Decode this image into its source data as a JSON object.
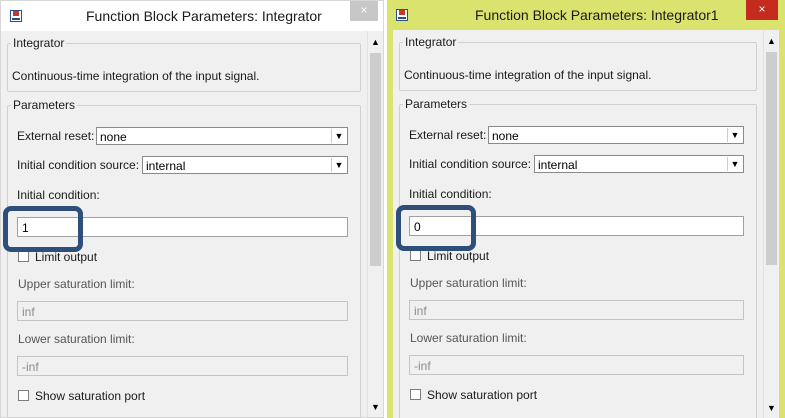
{
  "windows": [
    {
      "title": "Function Block Parameters: Integrator",
      "close_glyph": "×",
      "mask_type": "Integrator",
      "description": "Continuous-time integration of the input signal.",
      "parameters_title": "Parameters",
      "external_reset": {
        "label": "External reset:",
        "value": "none"
      },
      "initial_condition_source": {
        "label": "Initial condition source:",
        "value": "internal"
      },
      "initial_condition": {
        "label": "Initial condition:",
        "value": "1"
      },
      "limit_output": {
        "label": "Limit output",
        "checked": false
      },
      "upper_saturation_limit": {
        "label": "Upper saturation limit:",
        "value": "inf"
      },
      "lower_saturation_limit": {
        "label": "Lower saturation limit:",
        "value": "-inf"
      },
      "show_saturation_port": {
        "label": "Show saturation port",
        "checked": false
      },
      "focused": false
    },
    {
      "title": "Function Block Parameters: Integrator1",
      "close_glyph": "×",
      "mask_type": "Integrator",
      "description": "Continuous-time integration of the input signal.",
      "parameters_title": "Parameters",
      "external_reset": {
        "label": "External reset:",
        "value": "none"
      },
      "initial_condition_source": {
        "label": "Initial condition source:",
        "value": "internal"
      },
      "initial_condition": {
        "label": "Initial condition:",
        "value": "0"
      },
      "limit_output": {
        "label": "Limit output",
        "checked": false
      },
      "upper_saturation_limit": {
        "label": "Upper saturation limit:",
        "value": "inf"
      },
      "lower_saturation_limit": {
        "label": "Lower saturation limit:",
        "value": "-inf"
      },
      "show_saturation_port": {
        "label": "Show saturation port",
        "checked": false
      },
      "focused": true
    }
  ],
  "icons": [
    "simulink-block-icon",
    "close-icon",
    "dropdown-arrow-icon",
    "scroll-up-icon",
    "scroll-down-icon"
  ],
  "colors": {
    "active_frame": "#d9e36e",
    "close_active": "#c42b1c",
    "highlight_annotation": "#2e4f79"
  }
}
